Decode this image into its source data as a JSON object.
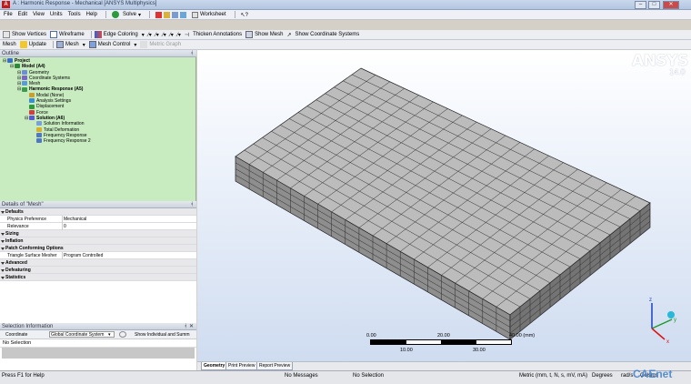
{
  "window": {
    "title": "A : Harmonic Response - Mechanical [ANSYS Multiphysics]"
  },
  "menu": [
    "File",
    "Edit",
    "View",
    "Units",
    "Tools",
    "Help"
  ],
  "toolbar1": {
    "solve": "Solve",
    "worksheet": "Worksheet"
  },
  "toolbar2": {
    "show_vertices": "Show Vertices",
    "wireframe": "Wireframe",
    "edge_coloring": "Edge Coloring",
    "thicken": "Thicken Annotations",
    "show_mesh": "Show Mesh",
    "show_csys": "Show Coordinate Systems"
  },
  "toolbar3": {
    "mesh": "Mesh",
    "update": "Update",
    "mesh_menu": "Mesh",
    "mesh_control": "Mesh Control",
    "metric_graph": "Metric Graph"
  },
  "outline": {
    "header": "Outline",
    "items": [
      {
        "label": "Project",
        "level": 0,
        "bold": true
      },
      {
        "label": "Model (A4)",
        "level": 1,
        "bold": true
      },
      {
        "label": "Geometry",
        "level": 2,
        "bold": false
      },
      {
        "label": "Coordinate Systems",
        "level": 2,
        "bold": false
      },
      {
        "label": "Mesh",
        "level": 2,
        "bold": false
      },
      {
        "label": "Harmonic Response (A5)",
        "level": 2,
        "bold": true
      },
      {
        "label": "Modal (None)",
        "level": 3,
        "bold": false
      },
      {
        "label": "Analysis Settings",
        "level": 3,
        "bold": false
      },
      {
        "label": "Displacement",
        "level": 3,
        "bold": false
      },
      {
        "label": "Force",
        "level": 3,
        "bold": false
      },
      {
        "label": "Solution (A6)",
        "level": 3,
        "bold": true
      },
      {
        "label": "Solution Information",
        "level": 4,
        "bold": false
      },
      {
        "label": "Total Deformation",
        "level": 4,
        "bold": false
      },
      {
        "label": "Frequency Response",
        "level": 4,
        "bold": false
      },
      {
        "label": "Frequency Response 2",
        "level": 4,
        "bold": false
      }
    ]
  },
  "details": {
    "header": "Details of \"Mesh\"",
    "rows": [
      {
        "type": "group",
        "label": "Defaults"
      },
      {
        "type": "row",
        "key": "Physics Preference",
        "value": "Mechanical"
      },
      {
        "type": "row",
        "key": "Relevance",
        "value": "0"
      },
      {
        "type": "group",
        "label": "Sizing"
      },
      {
        "type": "group",
        "label": "Inflation"
      },
      {
        "type": "group",
        "label": "Patch Conforming Options"
      },
      {
        "type": "row",
        "key": "Triangle Surface Mesher",
        "value": "Program Controlled"
      },
      {
        "type": "group",
        "label": "Advanced"
      },
      {
        "type": "group",
        "label": "Defeaturing"
      },
      {
        "type": "group",
        "label": "Statistics"
      }
    ]
  },
  "selection": {
    "header": "Selection Information",
    "col1": "Coordinate",
    "col2": "Global Coordinate System",
    "col3": "Show Individual and Summ",
    "row": "No Selection"
  },
  "viewport": {
    "logo": "ANSYS",
    "version": "14.0",
    "scale_top": [
      "0.00",
      "20.00",
      "40.00 (mm)"
    ],
    "scale_bottom": [
      "10.00",
      "30.00"
    ]
  },
  "tabs": [
    "Geometry",
    "Print Preview",
    "Report Preview"
  ],
  "status": {
    "help": "Press F1 for Help",
    "messages": "No Messages",
    "selection": "No Selection",
    "units": "Metric (mm, t, N, s, mV, mA)",
    "angle": "Degrees",
    "rate": "rad/s",
    "temp": "Celsius",
    "watermark": "CAEnet"
  }
}
